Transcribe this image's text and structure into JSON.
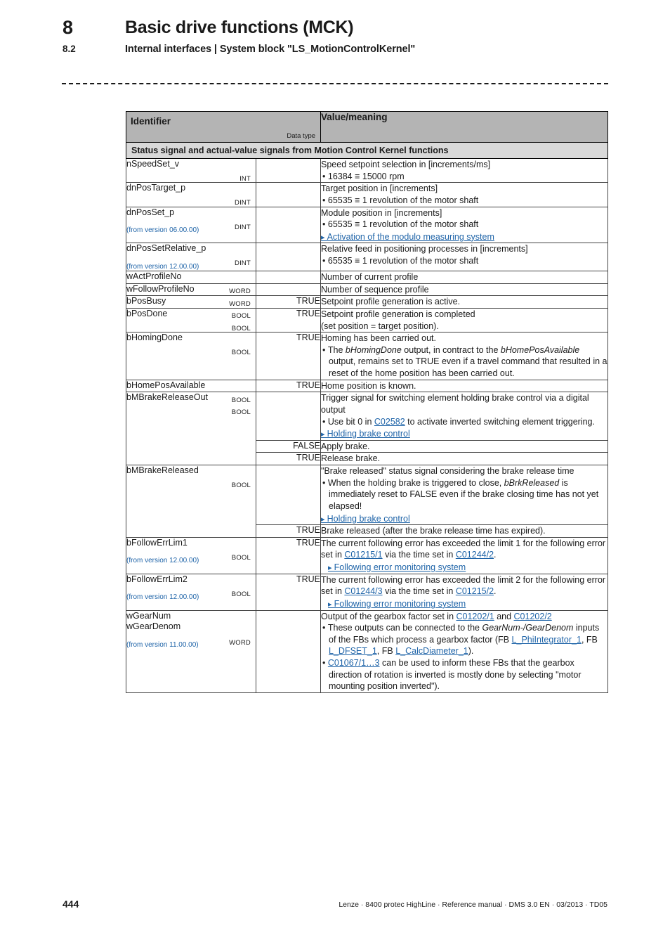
{
  "header": {
    "chapter_number": "8",
    "chapter_title": "Basic drive functions (MCK)",
    "section_number": "8.2",
    "section_title": "Internal interfaces | System block \"LS_MotionControlKernel\""
  },
  "table": {
    "columns": {
      "identifier": "Identifier",
      "data_type": "Data type",
      "value_meaning": "Value/meaning"
    },
    "section_band": "Status signal and actual-value signals from Motion Control Kernel functions",
    "rows": [
      {
        "identifier": "nSpeedSet_v",
        "data_type": "INT",
        "bool": "",
        "desc_line": "Speed setpoint selection in [increments/ms]",
        "bullet1": "16384 ≡ 15000 rpm"
      },
      {
        "identifier": "dnPosTarget_p",
        "data_type": "DINT",
        "bool": "",
        "desc_line": "Target position in [increments]",
        "bullet1": "65535 ≡ 1 revolution of the motor shaft"
      },
      {
        "identifier": "dnPosSet_p",
        "data_type": "DINT",
        "version": "(from version 06.00.00)",
        "bool": "",
        "desc_line": "Module position in [increments]",
        "bullet1": "65535 ≡ 1 revolution of the motor shaft",
        "link": "Activation of the modulo measuring system"
      },
      {
        "identifier": "dnPosSetRelative_p",
        "data_type": "DINT",
        "version": "(from version 12.00.00)",
        "bool": "",
        "desc_line": "Relative feed in positioning processes in [increments]",
        "bullet1": "65535 ≡ 1 revolution of the motor shaft"
      },
      {
        "identifier": "wActProfileNo",
        "data_type": "WORD",
        "bool": "",
        "desc_line": "Number of current profile"
      },
      {
        "identifier": "wFollowProfileNo",
        "data_type": "WORD",
        "bool": "",
        "desc_line": "Number of sequence profile"
      },
      {
        "identifier": "bPosBusy",
        "data_type": "BOOL",
        "bool": "TRUE",
        "desc_line": "Setpoint profile generation is active."
      },
      {
        "identifier": "bPosDone",
        "data_type": "BOOL",
        "bool": "TRUE",
        "desc_line": "Setpoint profile generation is completed",
        "desc_line2": "(set position = target position)."
      },
      {
        "identifier": "bHomingDone",
        "data_type": "BOOL",
        "bool": "TRUE",
        "desc_line": "Homing has been carried out.",
        "bullet_rich": {
          "p1": "The ",
          "i1": "bHomingDone",
          "p2": " output, in contract to the ",
          "i2": "bHomePosAvailable",
          "p3": " output, remains set to TRUE even if a travel command that resulted in a reset of the home position has been carried out."
        }
      },
      {
        "identifier": "bHomePosAvailable",
        "data_type": "BOOL",
        "bool": "TRUE",
        "desc_line": "Home position is known."
      },
      {
        "identifier": "bMBrakeReleaseOut",
        "data_type": "BOOL",
        "bool": "",
        "desc_line": "Trigger signal for switching element holding brake control via a digital output",
        "bullet_link": {
          "p1": "Use bit 0 in ",
          "link": "C02582",
          "p2": " to activate inverted switching element triggering."
        },
        "link": "Holding brake control",
        "subrows": [
          {
            "bool": "FALSE",
            "desc": "Apply brake."
          },
          {
            "bool": "TRUE",
            "desc": "Release brake."
          }
        ]
      },
      {
        "identifier": "bMBrakeReleased",
        "data_type": "BOOL",
        "bool": "",
        "desc_line": "\"Brake released\" status signal considering the brake release time",
        "bullet_rich": {
          "p1": "When the holding brake is triggered to close, ",
          "i1": "bBrkReleased",
          "p2": " is immediately reset to FALSE even if the brake closing time has not yet elapsed!"
        },
        "link": "Holding brake control",
        "subrows": [
          {
            "bool": "TRUE",
            "desc": "Brake released (after the brake release time has expired)."
          }
        ]
      },
      {
        "identifier": "bFollowErrLim1",
        "data_type": "BOOL",
        "version": "(from version 12.00.00)",
        "bool": "TRUE",
        "desc_rich": {
          "p1": "The current following error has exceeded the limit 1 for the following error set in ",
          "link1": "C01215/1",
          "p2": " via the time set in ",
          "link2": "C01244/2",
          "p3": "."
        },
        "link": "Following error monitoring system"
      },
      {
        "identifier": "bFollowErrLim2",
        "data_type": "BOOL",
        "version": "(from version 12.00.00)",
        "bool": "TRUE",
        "desc_rich": {
          "p1": "The current following error has exceeded the limit 2 for the following error set in ",
          "link1": "C01244/3",
          "p2": " via the time set in ",
          "link2": "C01215/2",
          "p3": "."
        },
        "link": "Following error monitoring system"
      },
      {
        "identifier": "wGearNum",
        "identifier2": "wGearDenom",
        "data_type": "WORD",
        "version": "(from version 11.00.00)",
        "bool": "",
        "gear": {
          "head_p1": "Output of the gearbox factor set in ",
          "head_link1": "C01202/1",
          "head_p2": " and ",
          "head_link2": "C01202/2",
          "b1_p1": "These outputs can be connected to the ",
          "b1_i1": "GearNum-/GearDenom",
          "b1_p2": " inputs of the FBs which process a gearbox factor (FB ",
          "b1_link1": "L_PhiIntegrator_1",
          "b1_p3": ", FB ",
          "b1_link2": "L_DFSET_1",
          "b1_p4": ", FB ",
          "b1_link3": "L_CalcDiameter_1",
          "b1_p5": ").",
          "b2_link1": "C01067/1…3",
          "b2_p1": " can be used to inform these FBs that the gearbox direction of rotation is inverted is mostly done by selecting \"motor mounting position inverted\")."
        }
      }
    ]
  },
  "footer": {
    "page_number": "444",
    "imprint": "Lenze · 8400 protec HighLine · Reference manual · DMS 3.0 EN · 03/2013 · TD05"
  }
}
